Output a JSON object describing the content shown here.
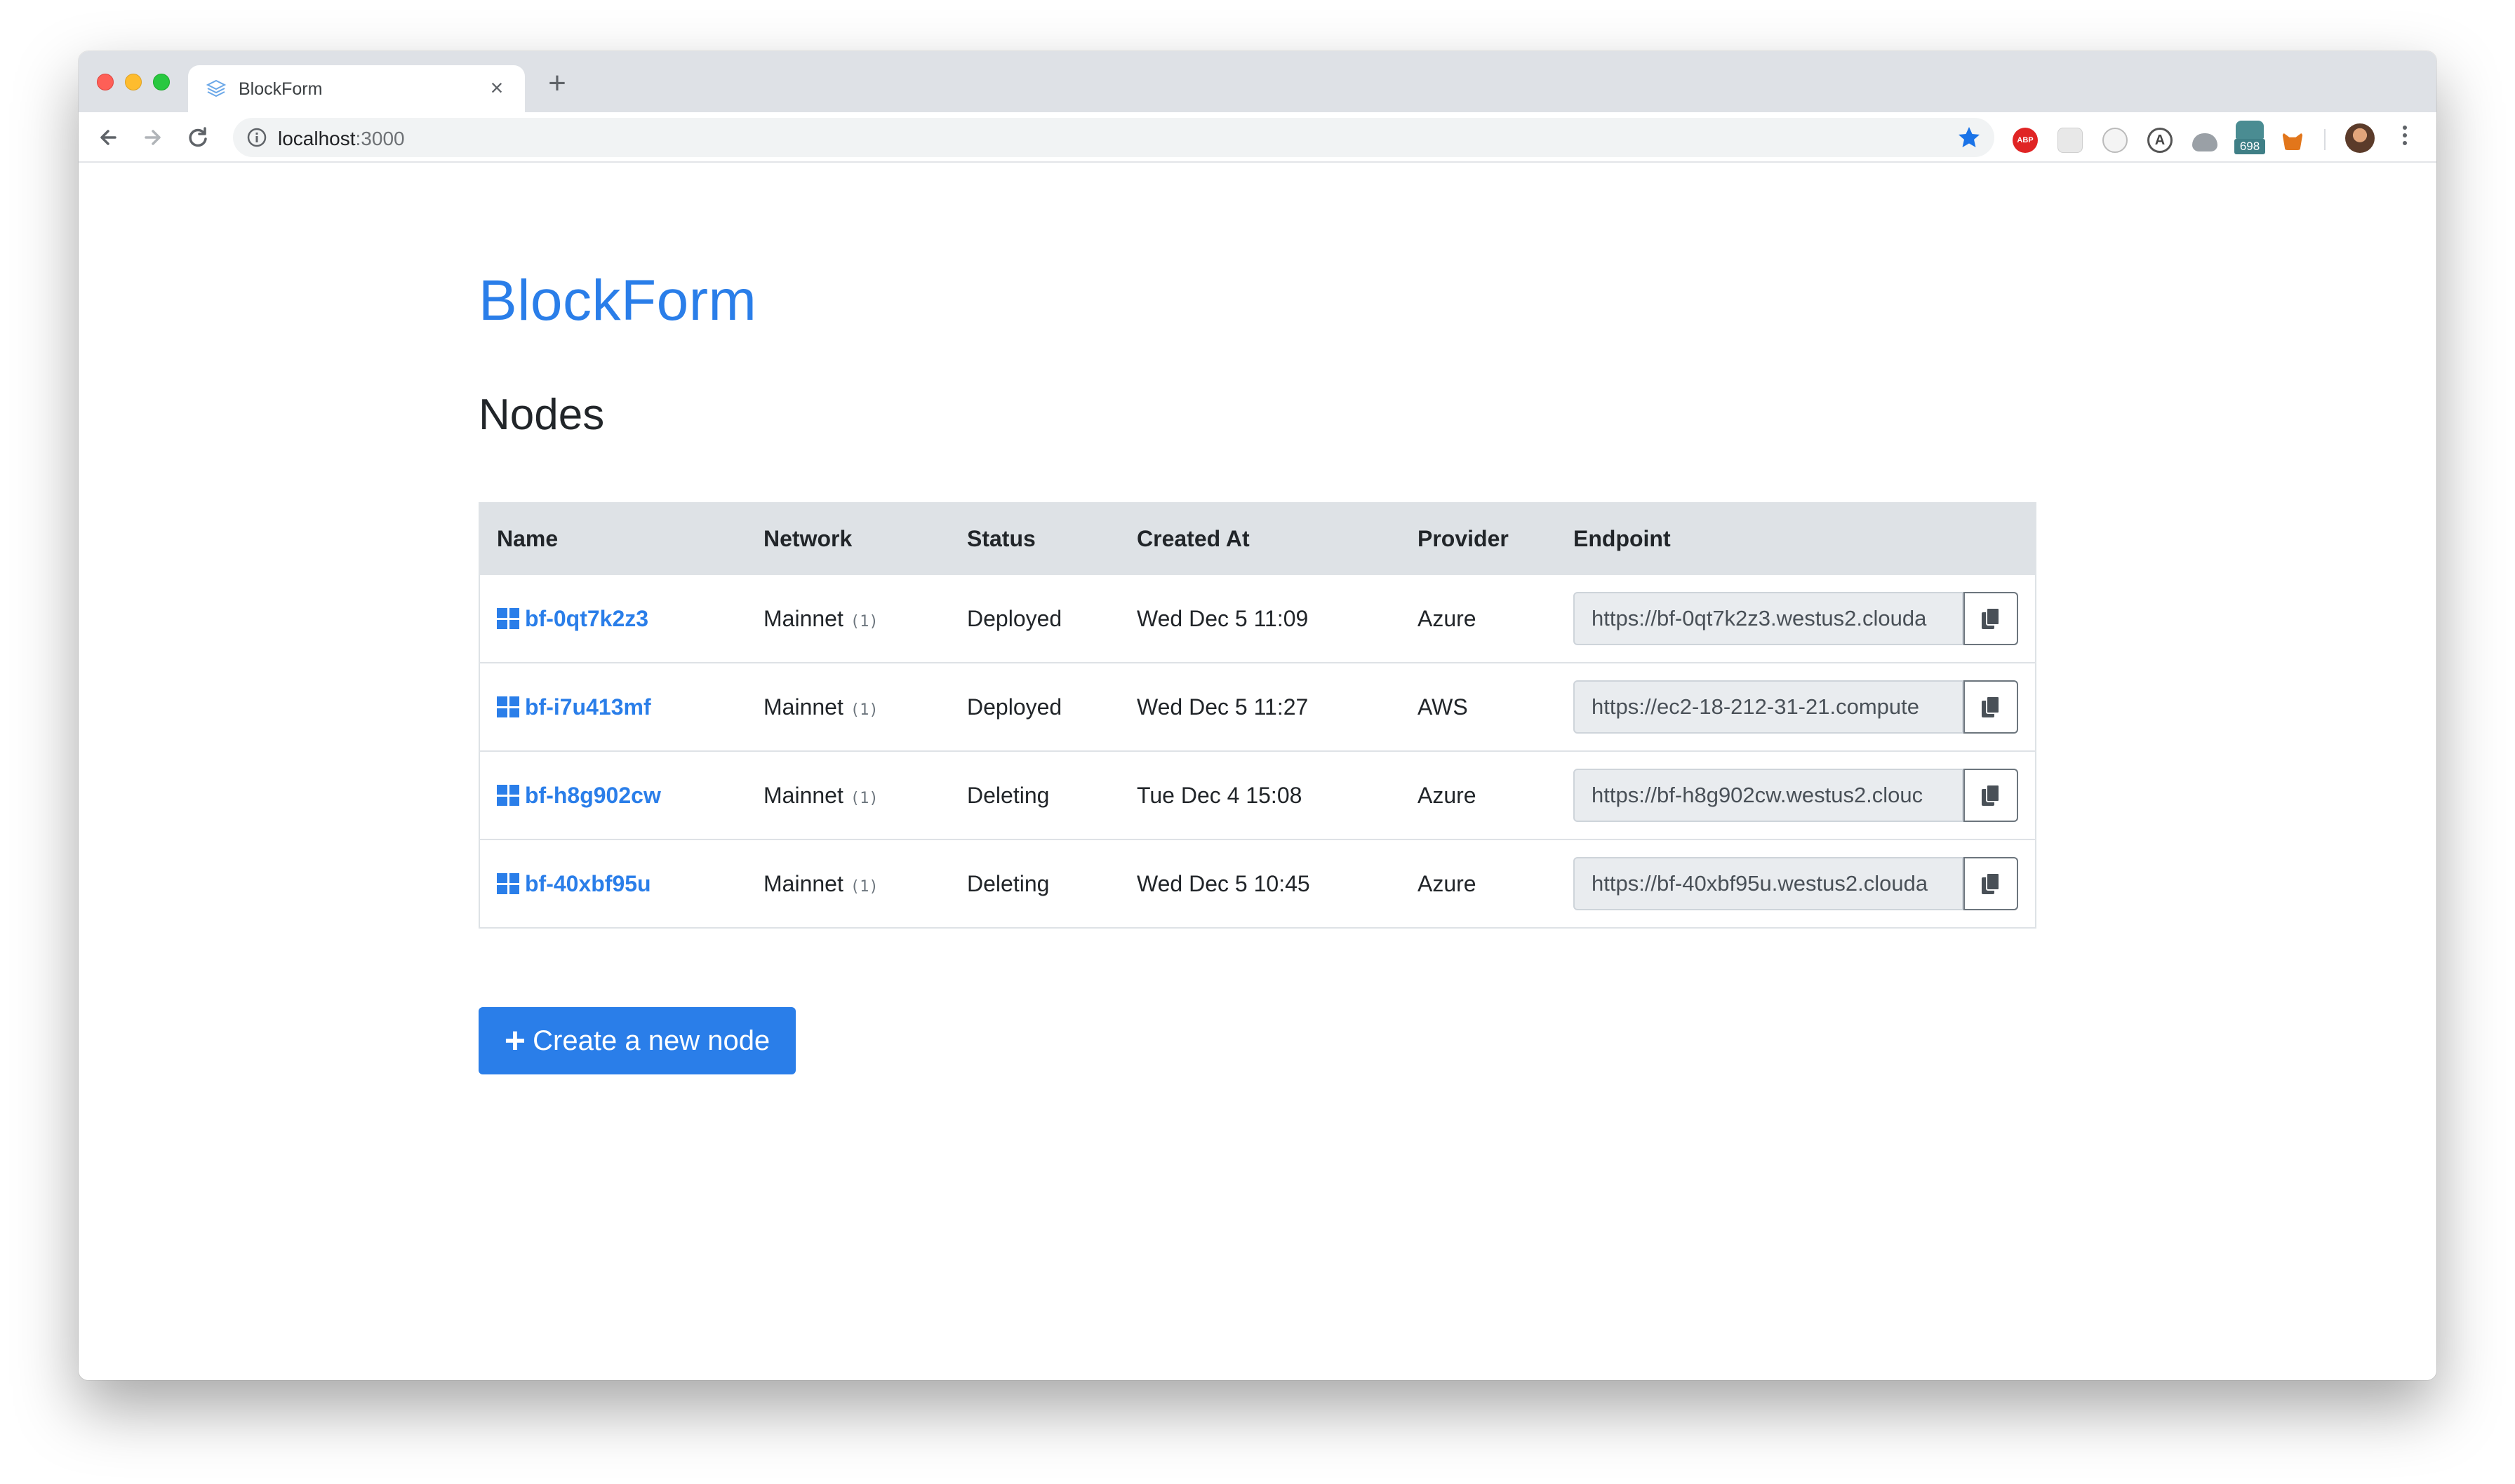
{
  "browser": {
    "tab_title": "BlockForm",
    "url_host": "localhost",
    "url_port": ":3000",
    "extension_badge": "698",
    "extension_abp_label": "ABP",
    "extension_a_label": "A"
  },
  "app": {
    "brand": "BlockForm",
    "section_title": "Nodes",
    "create_button_label": "Create a new node",
    "accent_color": "#2a7ee9"
  },
  "table": {
    "headers": {
      "name": "Name",
      "network": "Network",
      "status": "Status",
      "created_at": "Created At",
      "provider": "Provider",
      "endpoint": "Endpoint"
    },
    "rows": [
      {
        "name": "bf-0qt7k2z3",
        "network": "Mainnet",
        "network_id": "(1)",
        "status": "Deployed",
        "created_at": "Wed Dec 5 11:09",
        "provider": "Azure",
        "endpoint": "https://bf-0qt7k2z3.westus2.clouda"
      },
      {
        "name": "bf-i7u413mf",
        "network": "Mainnet",
        "network_id": "(1)",
        "status": "Deployed",
        "created_at": "Wed Dec 5 11:27",
        "provider": "AWS",
        "endpoint": "https://ec2-18-212-31-21.compute"
      },
      {
        "name": "bf-h8g902cw",
        "network": "Mainnet",
        "network_id": "(1)",
        "status": "Deleting",
        "created_at": "Tue Dec 4 15:08",
        "provider": "Azure",
        "endpoint": "https://bf-h8g902cw.westus2.clouc"
      },
      {
        "name": "bf-40xbf95u",
        "network": "Mainnet",
        "network_id": "(1)",
        "status": "Deleting",
        "created_at": "Wed Dec 5 10:45",
        "provider": "Azure",
        "endpoint": "https://bf-40xbf95u.westus2.clouda"
      }
    ]
  }
}
